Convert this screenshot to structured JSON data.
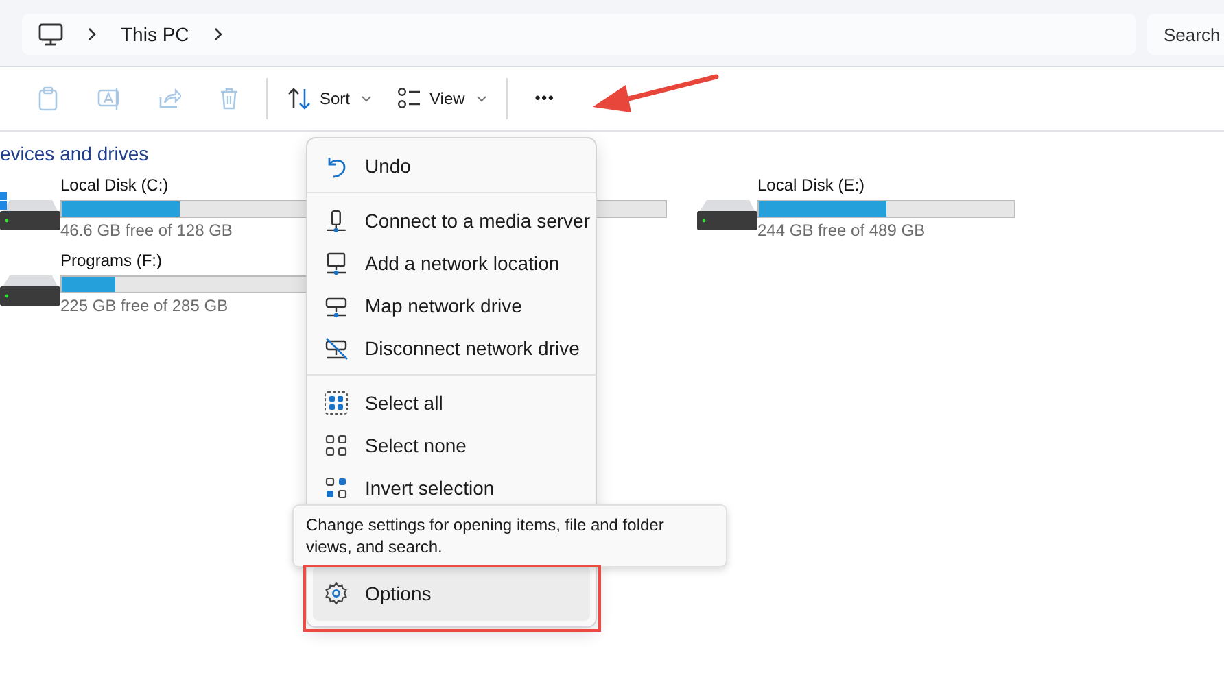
{
  "address_bar": {
    "crumbs": [
      "This PC"
    ]
  },
  "search": {
    "placeholder": "Search"
  },
  "toolbar": [
    {
      "kind": "copy",
      "disabled": true
    },
    {
      "kind": "rename",
      "disabled": true
    },
    {
      "kind": "share",
      "disabled": true
    },
    {
      "kind": "delete",
      "disabled": true
    },
    {
      "kind": "divider"
    },
    {
      "kind": "sort",
      "label": "Sort",
      "disabled": false
    },
    {
      "kind": "view",
      "label": "View",
      "disabled": false
    },
    {
      "kind": "divider"
    },
    {
      "kind": "more",
      "label": "•••",
      "disabled": false
    }
  ],
  "section_title": "evices and drives",
  "drives": [
    {
      "kind": "system",
      "name": "Local Disk (C:)",
      "level": 0.46,
      "free": "46.6 GB free of 128 GB"
    },
    {
      "kind": "hidden"
    },
    {
      "kind": "disk",
      "name": "Local Disk (E:)",
      "level": 0.5,
      "free": "244 GB free of 489 GB"
    },
    {
      "kind": "disk",
      "name": "Programs (F:)",
      "level": 0.21,
      "free": "225 GB free of 285 GB"
    }
  ],
  "menu": [
    {
      "kind": "item",
      "label": "Undo",
      "selected": false
    },
    {
      "kind": "separator"
    },
    {
      "kind": "item",
      "label": "Connect to a media server",
      "selected": false
    },
    {
      "kind": "item",
      "label": "Add a network location",
      "selected": false
    },
    {
      "kind": "item",
      "label": "Map network drive",
      "selected": false
    },
    {
      "kind": "item",
      "label": "Disconnect network drive",
      "selected": false
    },
    {
      "kind": "separator"
    },
    {
      "kind": "item",
      "label": "Select all",
      "selected": false
    },
    {
      "kind": "item",
      "label": "Select none",
      "selected": false
    },
    {
      "kind": "item",
      "label": "Invert selection",
      "selected": false
    },
    {
      "kind": "blank"
    },
    {
      "kind": "item",
      "label": "Options",
      "selected": true
    }
  ],
  "tooltip": "Change settings for opening items, file and folder views, and search."
}
